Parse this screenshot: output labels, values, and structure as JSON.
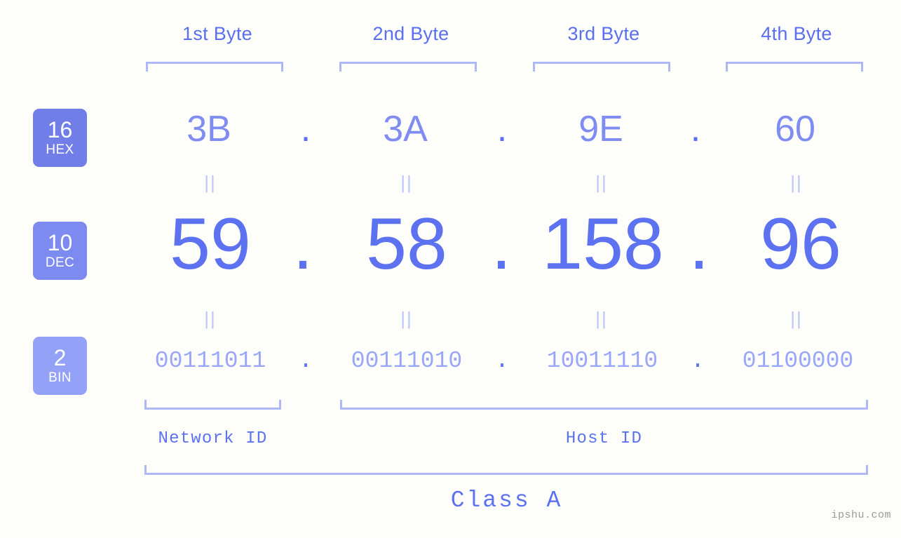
{
  "background_color": "#fdfefa",
  "accent_color": "#5c72f0",
  "accent_light": "#9aa6f8",
  "bracket_color": "#aeb8f7",
  "byte_headers": [
    {
      "label": "1st Byte"
    },
    {
      "label": "2nd Byte"
    },
    {
      "label": "3rd Byte"
    },
    {
      "label": "4th Byte"
    }
  ],
  "bases": [
    {
      "number": "16",
      "name": "HEX",
      "color": "#717ee8"
    },
    {
      "number": "10",
      "name": "DEC",
      "color": "#7d8aef"
    },
    {
      "number": "2",
      "name": "BIN",
      "color": "#93a1f7"
    }
  ],
  "rows": {
    "hex": {
      "values": [
        "3B",
        "3A",
        "9E",
        "60"
      ],
      "separator": "."
    },
    "dec": {
      "values": [
        "59",
        "58",
        "158",
        "96"
      ],
      "separator": "."
    },
    "bin": {
      "values": [
        "00111011",
        "00111010",
        "10011110",
        "01100000"
      ],
      "separator": "."
    }
  },
  "equals_glyph": "||",
  "segments": [
    {
      "label": "Network ID"
    },
    {
      "label": "Host ID"
    }
  ],
  "class": {
    "label": "Class A"
  },
  "watermark": {
    "text": "ipshu.com"
  },
  "chart_data": {
    "type": "table",
    "title": "IP Address 59.58.158.96 byte breakdown",
    "columns": [
      "1st Byte",
      "2nd Byte",
      "3rd Byte",
      "4th Byte"
    ],
    "rows": [
      {
        "base": "16 HEX",
        "values": [
          "3B",
          "3A",
          "9E",
          "60"
        ]
      },
      {
        "base": "10 DEC",
        "values": [
          "59",
          "58",
          "158",
          "96"
        ]
      },
      {
        "base": "2 BIN",
        "values": [
          "00111011",
          "00111010",
          "10011110",
          "01100000"
        ]
      }
    ],
    "annotations": [
      "Network ID covers 1st byte",
      "Host ID covers 2nd-4th bytes",
      "Class A"
    ]
  }
}
